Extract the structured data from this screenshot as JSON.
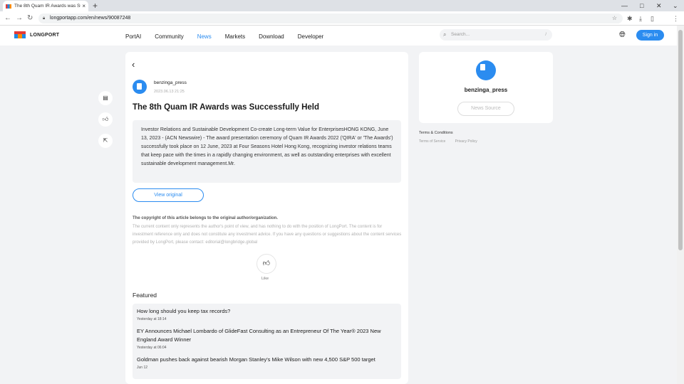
{
  "browser": {
    "tab_title": "The 8th Quam IR Awards was Su",
    "tab_close": "×",
    "new_tab": "+",
    "url": "longportapp.com/en/news/90087248",
    "win_min": "—",
    "win_max": "□",
    "win_close": "✕"
  },
  "header": {
    "logo_text": "LONGPORT",
    "nav": [
      "PortAI",
      "Community",
      "News",
      "Markets",
      "Download",
      "Developer"
    ],
    "active_nav": "News",
    "search_placeholder": "Search...",
    "search_shortcut": "/",
    "signin_label": "Sign in"
  },
  "article": {
    "author": "benzinga_press",
    "date": "2023.06.13 21:25",
    "title": "The 8th Quam IR Awards was Successfully Held",
    "summary": "Investor Relations and Sustainable Development Co-create Long-term Value for EnterprisesHONG KONG, June 13, 2023 - (ACN Newswire) - The award presentation ceremony of Quam IR Awards 2022 ('QIRA' or 'The Awards') successfully took place on 12 June, 2023 at Four Seasons Hotel Hong Kong, recognizing investor relations teams that keep pace with the times in a rapidly changing environment, as well as outstanding enterprises with excellent sustainable development management.Mr.",
    "view_original_label": "View original",
    "copyright_heading": "The copyright of this article belongs to the original author/organization.",
    "copyright_text": "The current content only represents the author's point of view, and has nothing to do with the position of LongPort. The content is for investment reference only and does not constitute any investment advice. If you have any questions or suggestions about the content services provided by LongPort, please contact: editorial@longbridge.global",
    "like_label": "Like"
  },
  "featured": {
    "heading": "Featured",
    "items": [
      {
        "title": "How long should you keep tax records?",
        "time": "Yesterday at 18:14"
      },
      {
        "title": "EY Announces Michael Lombardo of GlideFast Consulting as an Entrepreneur Of The Year® 2023 New England Award Winner",
        "time": "Yesterday at 06:04"
      },
      {
        "title": "Goldman pushes back against bearish Morgan Stanley's Mike Wilson with new 4,500 S&P 500 target",
        "time": "Jun 12"
      }
    ]
  },
  "sidebar_right": {
    "author": "benzinga_press",
    "news_source_label": "News Source",
    "terms_heading": "Terms & Conditions",
    "terms_links": [
      "Terms of Service",
      "Privacy Policy"
    ]
  },
  "colors": {
    "accent": "#2b8cf0",
    "page_bg": "#f2f3f5"
  }
}
